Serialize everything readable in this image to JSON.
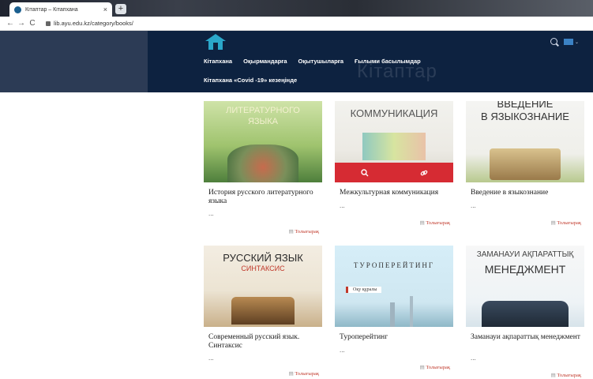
{
  "browser": {
    "tab_title": "Кітаптар – Кітапхана",
    "tab_close": "×",
    "new_tab": "+",
    "back": "←",
    "forward": "→",
    "reload": "C",
    "url": "lib.ayu.edu.kz/category/books/"
  },
  "header": {
    "nav": [
      "Кітапхана",
      "Оқырмандарға",
      "Оқытушыларға",
      "Ғылыми басылымдар"
    ],
    "nav2": "Кітапхана «Covid -19» кезеңінде",
    "watermark": "Кітаптар",
    "lang_chevron": "⌄"
  },
  "books": [
    {
      "title": "История русского литературного языка",
      "ellipsis": "...",
      "more": "Толығырақ",
      "cover_text": [
        "ЛИТЕРАТУРНОГО",
        "ЯЗЫКА"
      ]
    },
    {
      "title": "Межкультурная коммуникация",
      "ellipsis": "...",
      "more": "Толығырақ",
      "cover_text": [
        "КОММУНИКАЦИЯ"
      ]
    },
    {
      "title": "Введение в языкознание",
      "ellipsis": "...",
      "more": "Толығырақ",
      "cover_text": [
        "ВВЕДЕНИЕ",
        "В ЯЗЫКОЗНАНИЕ"
      ]
    },
    {
      "title": "Современный русский язык. Синтаксис",
      "ellipsis": "...",
      "more": "Толығырақ",
      "cover_text": [
        "РУССКИЙ ЯЗЫК",
        "СИНТАКСИС"
      ]
    },
    {
      "title": "Туроперейтинг",
      "ellipsis": "...",
      "more": "Толығырақ",
      "cover_text": [
        "ТУРОПЕРЕЙТИНГ",
        "Оқу құралы"
      ]
    },
    {
      "title": "Заманауи ақпараттық менеджмент",
      "ellipsis": "...",
      "more": "Толығырақ",
      "cover_text": [
        "ЗАМАНАУИ АҚПАРАТТЫҚ",
        "МЕНЕДЖМЕНТ"
      ]
    }
  ],
  "colors": {
    "header": "#0d2240",
    "accent": "#d62b33",
    "link": "#c0392b"
  },
  "icons": {
    "hover_left": "search-icon",
    "hover_right": "link-icon"
  }
}
